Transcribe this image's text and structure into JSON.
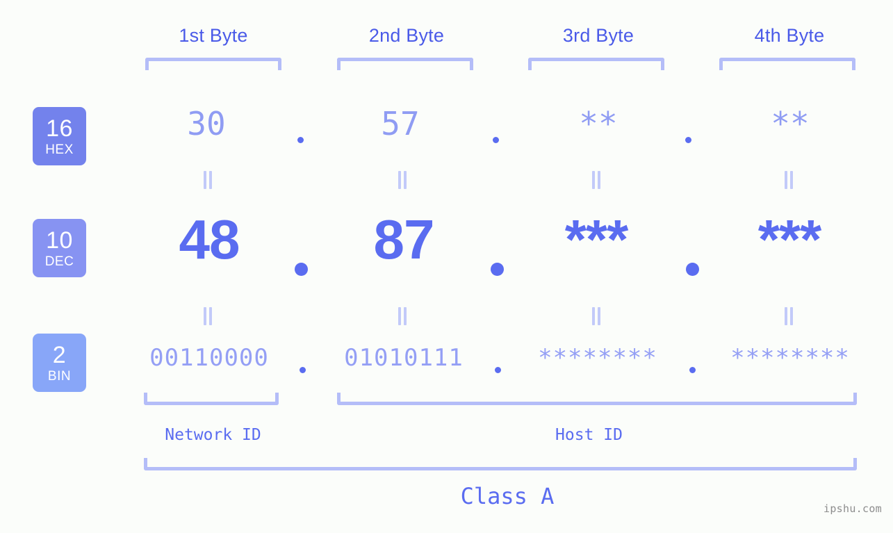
{
  "page": {
    "background_color": "#fbfdfa",
    "watermark": "ipshu.com"
  },
  "colors": {
    "header_text": "#4a5ae8",
    "bracket": "#b4bdf8",
    "hex_value": "#8f9cf3",
    "dec_value": "#5a6cf0",
    "bin_value": "#949ff5",
    "dot": "#5a6cf0",
    "equals": "#c2caf9",
    "badge_hex": "#7382ec",
    "badge_dec": "#8793f2",
    "badge_bin": "#88a6f8",
    "watermark": "#8d8d8d"
  },
  "headers": {
    "bytes": [
      {
        "label": "1st Byte"
      },
      {
        "label": "2nd Byte"
      },
      {
        "label": "3rd Byte"
      },
      {
        "label": "4th Byte"
      }
    ]
  },
  "bases": [
    {
      "number": "16",
      "name": "HEX"
    },
    {
      "number": "10",
      "name": "DEC"
    },
    {
      "number": "2",
      "name": "BIN"
    }
  ],
  "rows": {
    "hex": {
      "base_number": "16",
      "base_name": "HEX",
      "values": [
        "30",
        "57",
        "**",
        "**"
      ],
      "separators": [
        ".",
        ".",
        "."
      ]
    },
    "dec": {
      "base_number": "10",
      "base_name": "DEC",
      "values": [
        "48",
        "87",
        "***",
        "***"
      ],
      "separators": [
        ".",
        ".",
        "."
      ]
    },
    "bin": {
      "base_number": "2",
      "base_name": "BIN",
      "values": [
        "00110000",
        "01010111",
        "********",
        "********"
      ],
      "separators": [
        ".",
        ".",
        "."
      ]
    }
  },
  "equals_marks": {
    "glyph": "||",
    "count_row1": 4,
    "count_row2": 4
  },
  "footer": {
    "network_id_label": "Network ID",
    "host_id_label": "Host ID",
    "class_label": "Class A"
  }
}
